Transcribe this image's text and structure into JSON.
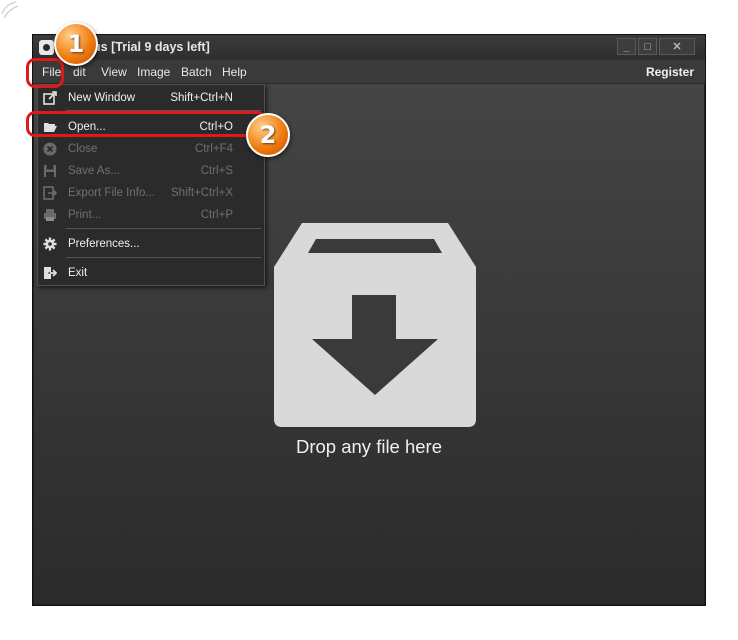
{
  "window": {
    "title": "IrfanView... Plus [Trial 9 days left]",
    "title_visible": "ver Plus [Trial 9 days left]",
    "controls": [
      "_",
      "□",
      "✕"
    ]
  },
  "menubar": {
    "items": [
      "File",
      "Edit",
      "View",
      "Image",
      "Batch",
      "Help"
    ],
    "file_visible": "File",
    "edit_visible": "dit",
    "register": "Register"
  },
  "file_menu": {
    "items": [
      {
        "label": "New Window",
        "shortcut": "Shift+Ctrl+N",
        "icon": "new-window-icon",
        "enabled": true
      },
      {
        "label": "Open...",
        "shortcut": "Ctrl+O",
        "icon": "folder-open-icon",
        "enabled": true
      },
      {
        "label": "Close",
        "shortcut": "Ctrl+F4",
        "icon": "close-circle-icon",
        "enabled": false
      },
      {
        "label": "Save As...",
        "shortcut": "Ctrl+S",
        "icon": "floppy-icon",
        "enabled": false
      },
      {
        "label": "Export File Info...",
        "shortcut": "Shift+Ctrl+X",
        "icon": "export-icon",
        "enabled": false
      },
      {
        "label": "Print...",
        "shortcut": "Ctrl+P",
        "icon": "printer-icon",
        "enabled": false
      },
      {
        "label": "Preferences...",
        "shortcut": "",
        "icon": "gear-icon",
        "enabled": true
      },
      {
        "label": "Exit",
        "shortcut": "",
        "icon": "exit-door-icon",
        "enabled": true
      }
    ]
  },
  "drop_zone": {
    "text": "Drop any file here",
    "icon": "download-box-icon"
  },
  "annotations": {
    "step1": "1",
    "step2": "2",
    "highlight_color": "#e01818",
    "callout_color": "#f07d12"
  }
}
